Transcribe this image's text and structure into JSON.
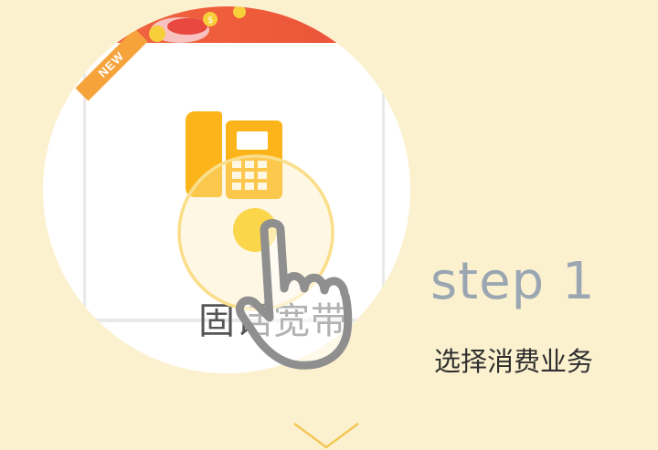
{
  "card": {
    "badge": "NEW",
    "service_label": "固话宽带"
  },
  "step": {
    "title": "step 1",
    "description": "选择消费业务"
  },
  "icons": {
    "service": "landline-phone-icon",
    "pointer": "pointing-hand-icon",
    "next": "chevron-down-icon"
  },
  "colors": {
    "background": "#fcf1cf",
    "accent": "#fbb51a",
    "banner": "#ee5a3a",
    "step_title": "#9aa7b2"
  }
}
